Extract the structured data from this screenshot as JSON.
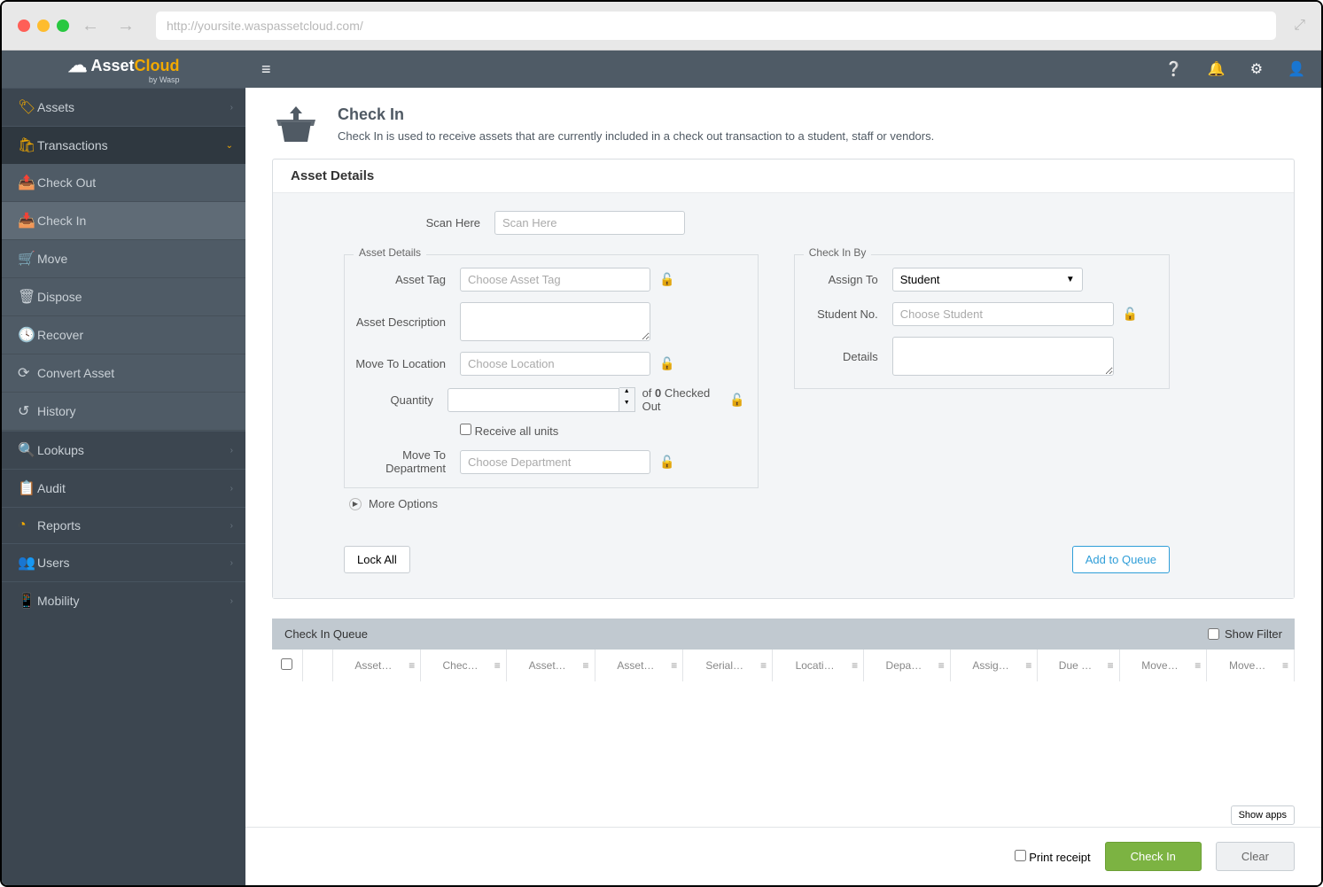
{
  "browser": {
    "url": "http://yoursite.waspassetcloud.com/"
  },
  "brand": {
    "name1": "Asset",
    "name2": "Cloud",
    "sub": "by Wasp"
  },
  "sidebar": {
    "assets": "Assets",
    "transactions": "Transactions",
    "sub": {
      "checkout": "Check Out",
      "checkin": "Check In",
      "move": "Move",
      "dispose": "Dispose",
      "recover": "Recover",
      "convert": "Convert Asset",
      "history": "History"
    },
    "lookups": "Lookups",
    "audit": "Audit",
    "reports": "Reports",
    "users": "Users",
    "mobility": "Mobility"
  },
  "page": {
    "title": "Check In",
    "desc": "Check In is used to receive assets that are currently included in a check out transaction to a student, staff or vendors."
  },
  "panel": {
    "heading": "Asset Details",
    "scan_label": "Scan Here",
    "scan_placeholder": "Scan Here",
    "fs_asset": "Asset Details",
    "asset_tag_label": "Asset Tag",
    "asset_tag_placeholder": "Choose Asset Tag",
    "asset_desc_label": "Asset Description",
    "move_loc_label": "Move To Location",
    "move_loc_placeholder": "Choose Location",
    "qty_label": "Quantity",
    "qty_of_pre": "of ",
    "qty_of_num": "0",
    "qty_of_post": " Checked Out",
    "recv_all": "Receive all units",
    "move_dept_label": "Move To Department",
    "move_dept_placeholder": "Choose Department",
    "fs_checkinby": "Check In By",
    "assign_to_label": "Assign To",
    "assign_to_value": "Student",
    "student_no_label": "Student No.",
    "student_no_placeholder": "Choose Student",
    "details_label": "Details",
    "more_options": "More Options",
    "lock_all": "Lock All",
    "add_queue": "Add to Queue"
  },
  "queue": {
    "title": "Check In Queue",
    "show_filter": "Show Filter",
    "cols": [
      "Asset…",
      "Chec…",
      "Asset…",
      "Asset…",
      "Serial…",
      "Locati…",
      "Depa…",
      "Assig…",
      "Due …",
      "Move…",
      "Move…"
    ]
  },
  "footer": {
    "print": "Print receipt",
    "checkin": "Check In",
    "clear": "Clear",
    "show_apps": "Show apps"
  }
}
